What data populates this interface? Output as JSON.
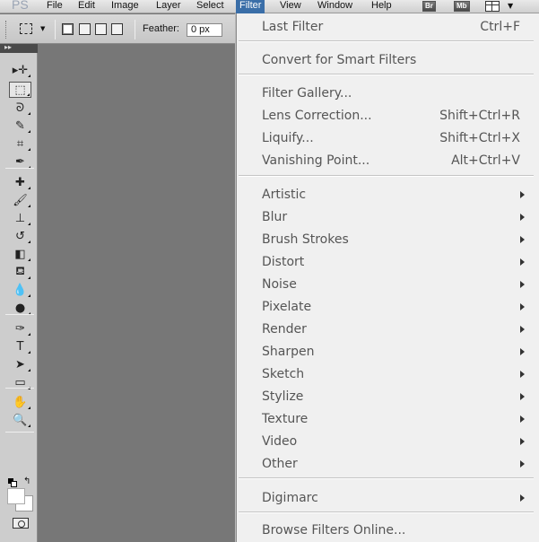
{
  "app": {
    "logo": "PS"
  },
  "menubar": {
    "items": [
      {
        "label": "File"
      },
      {
        "label": "Edit"
      },
      {
        "label": "Image"
      },
      {
        "label": "Layer"
      },
      {
        "label": "Select"
      },
      {
        "label": "Filter"
      },
      {
        "label": "View"
      },
      {
        "label": "Window"
      },
      {
        "label": "Help"
      }
    ],
    "bridge_label": "Br",
    "minibridge_label": "Mb"
  },
  "options": {
    "feather_label": "Feather:",
    "feather_value": "0 px"
  },
  "tools": [
    {
      "name": "move-tool-icon",
      "glyph": "▸✛"
    },
    {
      "name": "marquee-tool-icon",
      "glyph": "⬚",
      "active": true
    },
    {
      "name": "lasso-tool-icon",
      "glyph": "ᘐ"
    },
    {
      "name": "quick-select-tool-icon",
      "glyph": "✎"
    },
    {
      "name": "crop-tool-icon",
      "glyph": "⌗"
    },
    {
      "name": "eyedropper-tool-icon",
      "glyph": "✒"
    },
    {
      "name": "healing-brush-tool-icon",
      "glyph": "✚"
    },
    {
      "name": "brush-tool-icon",
      "glyph": "🖌"
    },
    {
      "name": "clone-stamp-tool-icon",
      "glyph": "⊥"
    },
    {
      "name": "history-brush-tool-icon",
      "glyph": "↺"
    },
    {
      "name": "eraser-tool-icon",
      "glyph": "◧"
    },
    {
      "name": "paint-bucket-tool-icon",
      "glyph": "⛾"
    },
    {
      "name": "blur-tool-icon",
      "glyph": "💧"
    },
    {
      "name": "dodge-tool-icon",
      "glyph": "●"
    },
    {
      "name": "pen-tool-icon",
      "glyph": "✑"
    },
    {
      "name": "type-tool-icon",
      "glyph": "T"
    },
    {
      "name": "path-select-tool-icon",
      "glyph": "➤"
    },
    {
      "name": "shape-tool-icon",
      "glyph": "▭"
    },
    {
      "name": "hand-tool-icon",
      "glyph": "✋"
    },
    {
      "name": "zoom-tool-icon",
      "glyph": "🔍"
    }
  ],
  "filter_menu": {
    "items": [
      {
        "label": "Last Filter",
        "shortcut": "Ctrl+F"
      },
      {
        "sep": true
      },
      {
        "label": "Convert for Smart Filters"
      },
      {
        "sep": true
      },
      {
        "label": "Filter Gallery..."
      },
      {
        "label": "Lens Correction...",
        "shortcut": "Shift+Ctrl+R"
      },
      {
        "label": "Liquify...",
        "shortcut": "Shift+Ctrl+X"
      },
      {
        "label": "Vanishing Point...",
        "shortcut": "Alt+Ctrl+V"
      },
      {
        "sep": true
      },
      {
        "label": "Artistic",
        "submenu": true
      },
      {
        "label": "Blur",
        "submenu": true
      },
      {
        "label": "Brush Strokes",
        "submenu": true
      },
      {
        "label": "Distort",
        "submenu": true
      },
      {
        "label": "Noise",
        "submenu": true
      },
      {
        "label": "Pixelate",
        "submenu": true
      },
      {
        "label": "Render",
        "submenu": true
      },
      {
        "label": "Sharpen",
        "submenu": true
      },
      {
        "label": "Sketch",
        "submenu": true
      },
      {
        "label": "Stylize",
        "submenu": true
      },
      {
        "label": "Texture",
        "submenu": true
      },
      {
        "label": "Video",
        "submenu": true
      },
      {
        "label": "Other",
        "submenu": true
      },
      {
        "sep": true
      },
      {
        "label": "Digimarc",
        "submenu": true
      },
      {
        "sep": true
      },
      {
        "label": "Browse Filters Online..."
      }
    ]
  }
}
